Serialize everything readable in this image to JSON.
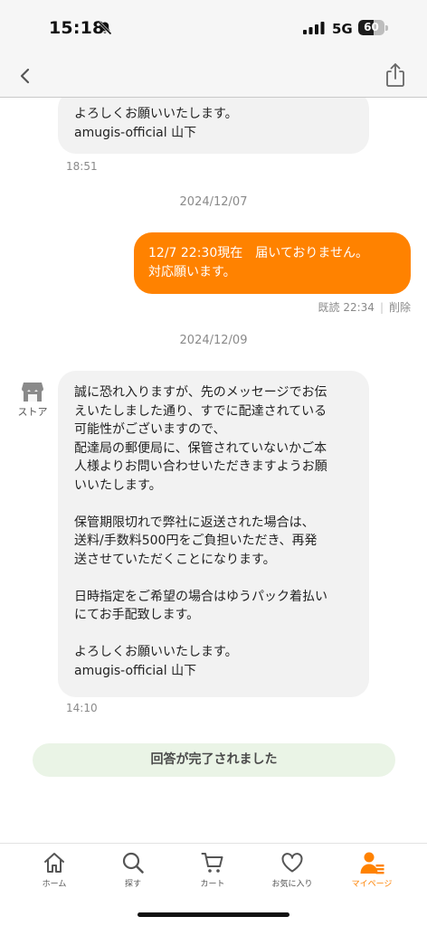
{
  "status_bar": {
    "time": "15:18",
    "network": "5G",
    "battery": "60",
    "battery_level": 0.6
  },
  "nav": {
    "back_icon": "chevron-left-icon",
    "share_icon": "share-icon"
  },
  "messages": {
    "msg1": {
      "lines": "よろしくお願いいたします。\namugis-official 山下",
      "time": "18:51"
    },
    "date1": "2024/12/07",
    "msg2": {
      "text": "12/7 22:30現在　届いておりません。\n対応願います。",
      "read_label": "既読 22:34",
      "delete_label": "削除"
    },
    "date2": "2024/12/09",
    "store_label": "ストア",
    "msg3": {
      "paragraphs": [
        "誠に恐れ入りますが、先のメッセージでお伝\nえいたしました通り、すでに配達されている\n可能性がございますので、\n配達局の郵便局に、保管されていないかご本\n人様よりお問い合わせいただきますようお願\nいいたします。",
        "保管期限切れで弊社に返送された場合は、\n送料/手数料500円をご負担いただき、再発\n送させていただくことになります。",
        "日時指定をご希望の場合はゆうパック着払い\nにてお手配致します。",
        "よろしくお願いいたします。\namugis-official 山下"
      ],
      "time": "14:10"
    },
    "complete_banner": "回答が完了されました"
  },
  "tabs": [
    {
      "label": "ホーム",
      "icon": "home-icon",
      "active": false
    },
    {
      "label": "探す",
      "icon": "search-icon",
      "active": false
    },
    {
      "label": "カート",
      "icon": "cart-icon",
      "active": false
    },
    {
      "label": "お気に入り",
      "icon": "heart-icon",
      "active": false
    },
    {
      "label": "マイページ",
      "icon": "person-icon",
      "active": true
    }
  ],
  "colors": {
    "accent": "#ff8200",
    "incoming_bubble": "#f2f2f2",
    "banner_bg": "#eaf4e6"
  }
}
